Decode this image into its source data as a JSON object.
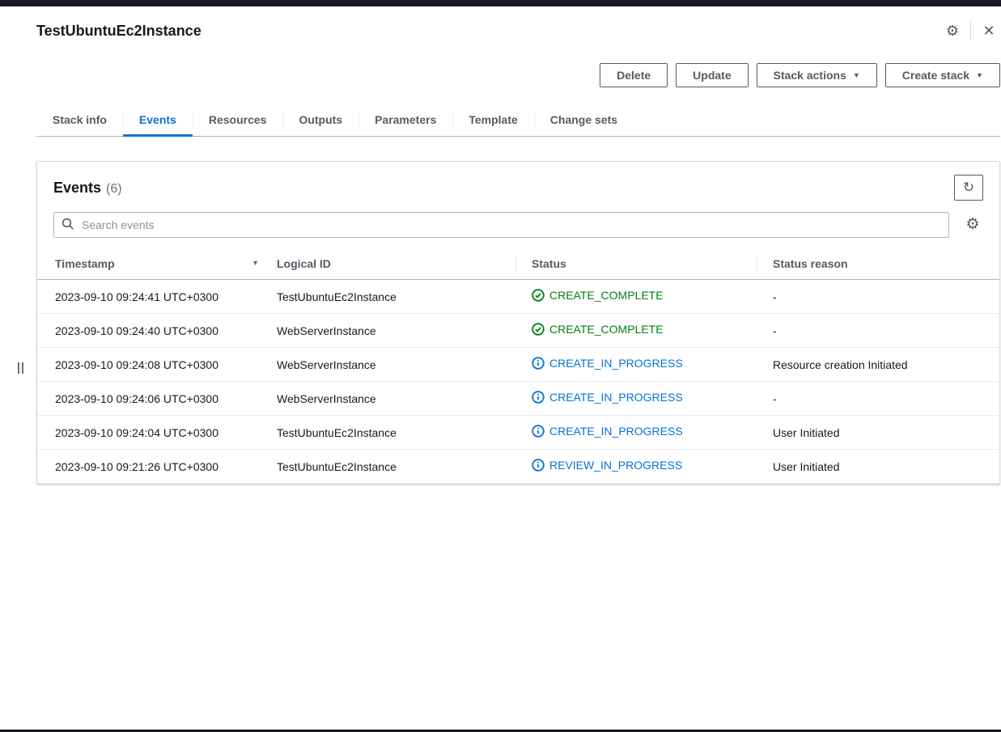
{
  "panel": {
    "title": "TestUbuntuEc2Instance"
  },
  "icons": {
    "gear": "⚙",
    "close": "✕",
    "refresh": "↻",
    "caret_down": "▼",
    "sort_desc": "▼"
  },
  "toolbar": {
    "delete_label": "Delete",
    "update_label": "Update",
    "stack_actions_label": "Stack actions",
    "create_stack_label": "Create stack"
  },
  "tabs": [
    "Stack info",
    "Events",
    "Resources",
    "Outputs",
    "Parameters",
    "Template",
    "Change sets"
  ],
  "events": {
    "title": "Events",
    "count": "(6)",
    "search_placeholder": "Search events"
  },
  "table": {
    "columns": [
      "Timestamp",
      "Logical ID",
      "Status",
      "Status reason"
    ],
    "rows": [
      {
        "timestamp": "2023-09-10 09:24:41 UTC+0300",
        "logical_id": "TestUbuntuEc2Instance",
        "status": "CREATE_COMPLETE",
        "status_type": "success",
        "reason": "-"
      },
      {
        "timestamp": "2023-09-10 09:24:40 UTC+0300",
        "logical_id": "WebServerInstance",
        "status": "CREATE_COMPLETE",
        "status_type": "success",
        "reason": "-"
      },
      {
        "timestamp": "2023-09-10 09:24:08 UTC+0300",
        "logical_id": "WebServerInstance",
        "status": "CREATE_IN_PROGRESS",
        "status_type": "info",
        "reason": "Resource creation Initiated"
      },
      {
        "timestamp": "2023-09-10 09:24:06 UTC+0300",
        "logical_id": "WebServerInstance",
        "status": "CREATE_IN_PROGRESS",
        "status_type": "info",
        "reason": "-"
      },
      {
        "timestamp": "2023-09-10 09:24:04 UTC+0300",
        "logical_id": "TestUbuntuEc2Instance",
        "status": "CREATE_IN_PROGRESS",
        "status_type": "info",
        "reason": "User Initiated"
      },
      {
        "timestamp": "2023-09-10 09:21:26 UTC+0300",
        "logical_id": "TestUbuntuEc2Instance",
        "status": "REVIEW_IN_PROGRESS",
        "status_type": "info",
        "reason": "User Initiated"
      }
    ]
  },
  "colors": {
    "accent": "#0972d3",
    "success": "#037f0c",
    "topbar": "#16191f"
  }
}
